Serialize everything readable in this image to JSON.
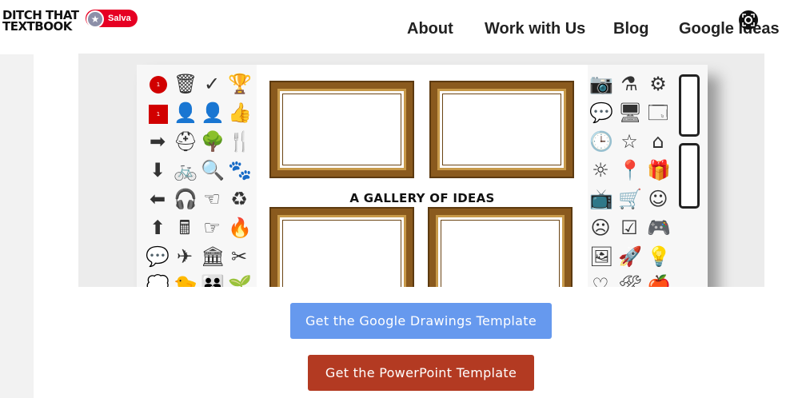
{
  "header": {
    "logo_line1": "DITCH THAT",
    "logo_line2": "TEXTBOOK",
    "save_badge": "Salva"
  },
  "nav": {
    "about": "About",
    "work": "Work with Us",
    "blog": "Blog",
    "google": "Google Ideas"
  },
  "image": {
    "title": "A GALLERY OF IDEAS",
    "badge_numbers": [
      "1",
      "1"
    ]
  },
  "buttons": {
    "drawings": "Get the Google Drawings Template",
    "ppt": "Get the PowerPoint Template"
  },
  "colors": {
    "save_red": "#e60023",
    "drawings_button": "#6699ee",
    "ppt_button": "#b33a22"
  },
  "icons": {
    "lens": "google-lens-icon",
    "star": "star-icon"
  }
}
